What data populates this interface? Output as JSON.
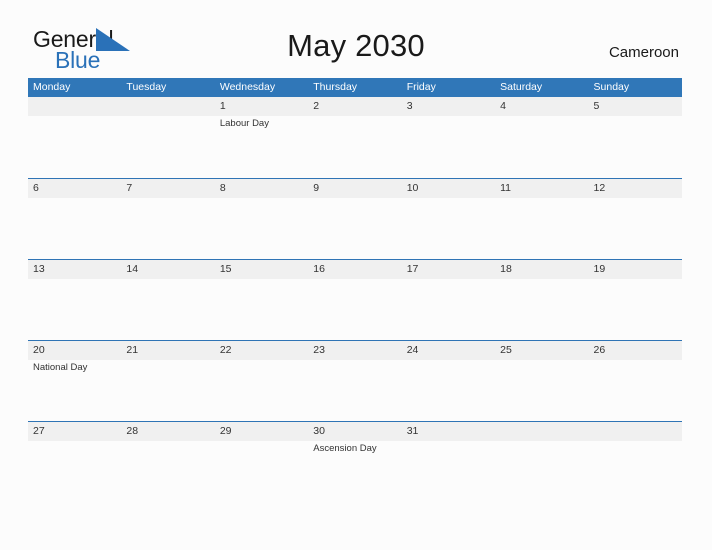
{
  "brand": {
    "name_part1": "General",
    "name_part2": "Blue",
    "flag_icon": "blue-triangle-flag-icon",
    "colors": {
      "general": "#1a1a1a",
      "blue": "#2a71b8",
      "flag": "#2a71b8"
    }
  },
  "header": {
    "title": "May 2030",
    "country": "Cameroon"
  },
  "colors": {
    "header_band": "#3077b8",
    "week_divider": "#2f74b5",
    "date_band": "#f0f0f0",
    "page_background": "#fcfcfc",
    "text": "#333333"
  },
  "calendar": {
    "weekdays": [
      "Monday",
      "Tuesday",
      "Wednesday",
      "Thursday",
      "Friday",
      "Saturday",
      "Sunday"
    ],
    "weeks": [
      [
        {
          "day": "",
          "events": []
        },
        {
          "day": "",
          "events": []
        },
        {
          "day": "1",
          "events": [
            "Labour Day"
          ]
        },
        {
          "day": "2",
          "events": []
        },
        {
          "day": "3",
          "events": []
        },
        {
          "day": "4",
          "events": []
        },
        {
          "day": "5",
          "events": []
        }
      ],
      [
        {
          "day": "6",
          "events": []
        },
        {
          "day": "7",
          "events": []
        },
        {
          "day": "8",
          "events": []
        },
        {
          "day": "9",
          "events": []
        },
        {
          "day": "10",
          "events": []
        },
        {
          "day": "11",
          "events": []
        },
        {
          "day": "12",
          "events": []
        }
      ],
      [
        {
          "day": "13",
          "events": []
        },
        {
          "day": "14",
          "events": []
        },
        {
          "day": "15",
          "events": []
        },
        {
          "day": "16",
          "events": []
        },
        {
          "day": "17",
          "events": []
        },
        {
          "day": "18",
          "events": []
        },
        {
          "day": "19",
          "events": []
        }
      ],
      [
        {
          "day": "20",
          "events": [
            "National Day"
          ]
        },
        {
          "day": "21",
          "events": []
        },
        {
          "day": "22",
          "events": []
        },
        {
          "day": "23",
          "events": []
        },
        {
          "day": "24",
          "events": []
        },
        {
          "day": "25",
          "events": []
        },
        {
          "day": "26",
          "events": []
        }
      ],
      [
        {
          "day": "27",
          "events": []
        },
        {
          "day": "28",
          "events": []
        },
        {
          "day": "29",
          "events": []
        },
        {
          "day": "30",
          "events": [
            "Ascension Day"
          ]
        },
        {
          "day": "31",
          "events": []
        },
        {
          "day": "",
          "events": []
        },
        {
          "day": "",
          "events": []
        }
      ]
    ]
  }
}
